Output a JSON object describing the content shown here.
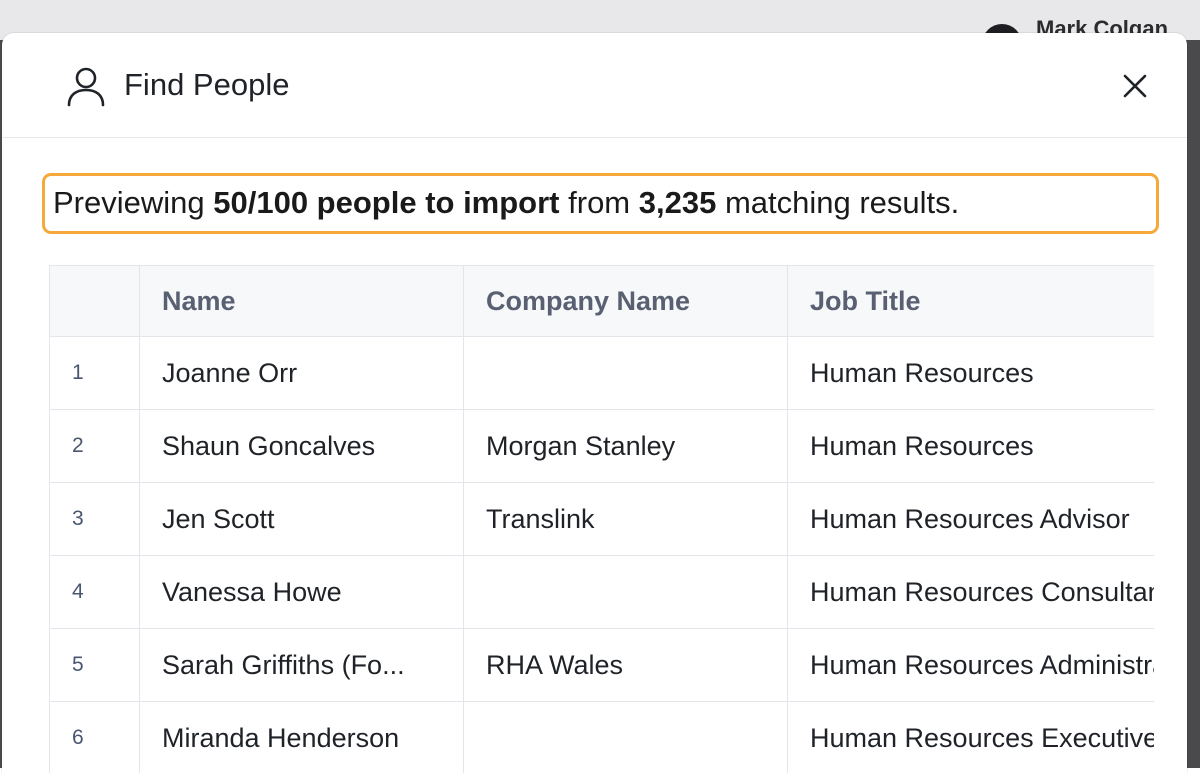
{
  "background": {
    "user_name": "Mark Colgan"
  },
  "modal": {
    "title": "Find People",
    "icons": {
      "title_icon": "user-icon",
      "close": "close-icon"
    }
  },
  "summary": {
    "prefix": "Previewing ",
    "highlight": "50/100 people to import",
    "middle": " from ",
    "count": "3,235",
    "suffix": " matching results.",
    "accent_color": "#f5a93a"
  },
  "table": {
    "columns": [
      "",
      "Name",
      "Company Name",
      "Job Title"
    ],
    "rows": [
      {
        "index": "1",
        "name": "Joanne Orr",
        "company": "",
        "job_title": "Human Resources"
      },
      {
        "index": "2",
        "name": "Shaun Goncalves",
        "company": "Morgan Stanley",
        "job_title": "Human Resources"
      },
      {
        "index": "3",
        "name": "Jen Scott",
        "company": "Translink",
        "job_title": "Human Resources Advisor"
      },
      {
        "index": "4",
        "name": "Vanessa Howe",
        "company": "",
        "job_title": "Human Resources Consultant"
      },
      {
        "index": "5",
        "name": "Sarah Griffiths (Fo...",
        "company": "RHA Wales",
        "job_title": "Human Resources Administrator"
      },
      {
        "index": "6",
        "name": "Miranda Henderson",
        "company": "",
        "job_title": "Human Resources Executive"
      }
    ]
  }
}
